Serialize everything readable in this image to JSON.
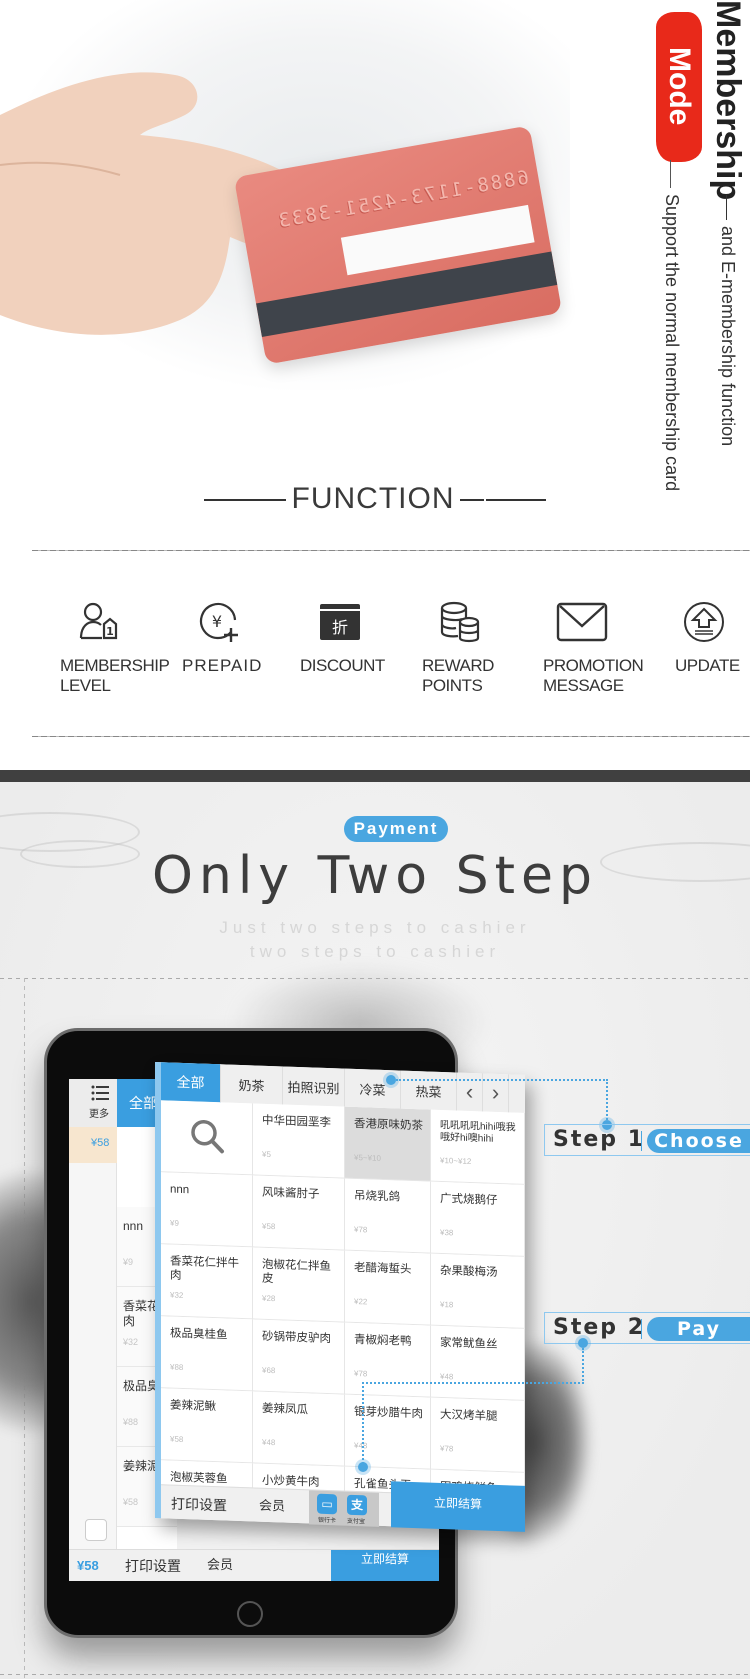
{
  "hero": {
    "mode_label": "Mode",
    "title": "Membership",
    "subtitle_1": "and E-membership function",
    "subtitle_2": "Support the normal membership card",
    "card_number": "6888-1173-4251-3833"
  },
  "function_section": {
    "title": "FUNCTION",
    "features": [
      {
        "icon": "member-level-icon",
        "label_1": "MEMBERSHIP",
        "label_2": "LEVEL"
      },
      {
        "icon": "prepaid-yen-icon",
        "label_1": "PREPAID",
        "label_2": ""
      },
      {
        "icon": "discount-icon",
        "icon_text": "折",
        "label_1": "DISCOUNT",
        "label_2": ""
      },
      {
        "icon": "reward-coins-icon",
        "label_1": "REWARD",
        "label_2": "POINTS"
      },
      {
        "icon": "envelope-icon",
        "label_1": "PROMOTION",
        "label_2": "MESSAGE"
      },
      {
        "icon": "update-arrow-icon",
        "label_1": "UPDATE",
        "label_2": ""
      }
    ]
  },
  "payment_section": {
    "badge": "Payment",
    "title": "Only Two Step",
    "subtitle_1": "Just two steps to cashier",
    "subtitle_2": "two steps to cashier",
    "steps": [
      {
        "label": "Step 1",
        "action": "Choose"
      },
      {
        "label": "Step 2",
        "action": "Pay"
      }
    ]
  },
  "back_screen": {
    "more_label": "更多",
    "all_tab": "全部",
    "price": "¥58",
    "items": [
      {
        "name": "nnn",
        "price": "¥9"
      },
      {
        "name": "香菜花肉",
        "price": "¥32"
      },
      {
        "name": "极品臭",
        "price": "¥88"
      },
      {
        "name": "姜辣泥",
        "price": "¥58"
      }
    ],
    "bottom": {
      "total": "¥58",
      "print": "打印设置",
      "member": "会员",
      "checkout": "立即结算"
    }
  },
  "app": {
    "tabs": [
      "全部",
      "奶茶",
      "拍照识别",
      "冷菜",
      "热菜"
    ],
    "active_tab": 0,
    "items": [
      {
        "name": "",
        "price": "",
        "search": true
      },
      {
        "name": "中华田园垩李",
        "price": "¥5"
      },
      {
        "name": "香港原味奶茶",
        "price": "¥5~¥10",
        "selected": true
      },
      {
        "name": "吼吼吼吼hihi哦我哦好hi噢hihi",
        "price": "¥10~¥12",
        "small": true
      },
      {
        "name": "nnn",
        "price": "¥9"
      },
      {
        "name": "风味酱肘子",
        "price": "¥58"
      },
      {
        "name": "吊烧乳鸽",
        "price": "¥78"
      },
      {
        "name": "广式烧鹅仔",
        "price": "¥38"
      },
      {
        "name": "香菜花仁拌牛肉",
        "price": "¥32"
      },
      {
        "name": "泡椒花仁拌鱼皮",
        "price": "¥28"
      },
      {
        "name": "老醋海蜇头",
        "price": "¥22"
      },
      {
        "name": "杂果酸梅汤",
        "price": "¥18"
      },
      {
        "name": "极品臭桂鱼",
        "price": "¥88"
      },
      {
        "name": "砂锅带皮驴肉",
        "price": "¥68"
      },
      {
        "name": "青椒焖老鸭",
        "price": "¥78"
      },
      {
        "name": "家常鱿鱼丝",
        "price": "¥48"
      },
      {
        "name": "姜辣泥鳅",
        "price": "¥58"
      },
      {
        "name": "姜辣凤瓜",
        "price": "¥48"
      },
      {
        "name": "银芽炒腊牛肉",
        "price": "¥48"
      },
      {
        "name": "大汉烤羊腿",
        "price": "¥78"
      },
      {
        "name": "泡椒芙蓉鱼",
        "price": ""
      },
      {
        "name": "小炒黄牛肉",
        "price": ""
      },
      {
        "name": "孔雀鱼头王",
        "price": ""
      },
      {
        "name": "田鸡烧鲜鱼",
        "price": ""
      }
    ],
    "bottom": {
      "print": "打印设置",
      "member": "会员",
      "bank_card": "银行卡",
      "alipay": "支付宝",
      "checkout": "立即结算"
    }
  },
  "colors": {
    "accent_blue": "#3a9ee0",
    "brush_red": "#e8291a",
    "card_pink": "#e3796e",
    "dark_band": "#404040"
  }
}
